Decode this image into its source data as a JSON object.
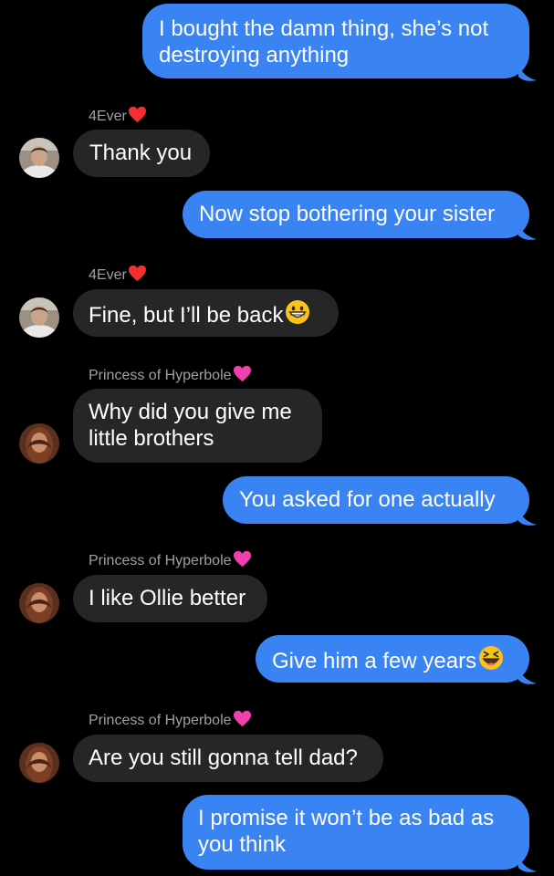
{
  "conversation": {
    "messages": [
      {
        "id": "m1",
        "direction": "outgoing",
        "lines": [
          "I bought the damn thing, she’s not",
          "destroying anything"
        ]
      },
      {
        "id": "m2",
        "direction": "incoming",
        "sender": "4Ever",
        "sender_emoji": "red-heart",
        "lines": [
          "Thank you"
        ]
      },
      {
        "id": "m3",
        "direction": "outgoing",
        "lines": [
          "Now stop bothering your sister"
        ]
      },
      {
        "id": "m4",
        "direction": "incoming",
        "sender": "4Ever",
        "sender_emoji": "red-heart",
        "lines": [
          "Fine, but I’ll be back"
        ],
        "trailing_emoji": "grinning-face"
      },
      {
        "id": "m5",
        "direction": "incoming",
        "sender": "Princess of Hyperbole",
        "sender_emoji": "pink-heart",
        "lines": [
          "Why did you give me",
          "little brothers"
        ]
      },
      {
        "id": "m6",
        "direction": "outgoing",
        "lines": [
          "You asked for one actually"
        ]
      },
      {
        "id": "m7",
        "direction": "incoming",
        "sender": "Princess of Hyperbole",
        "sender_emoji": "pink-heart",
        "lines": [
          "I like Ollie better"
        ]
      },
      {
        "id": "m8",
        "direction": "outgoing",
        "lines": [
          "Give him a few years"
        ],
        "trailing_emoji": "laughing-squinting-face"
      },
      {
        "id": "m9",
        "direction": "incoming",
        "sender": "Princess of Hyperbole",
        "sender_emoji": "pink-heart",
        "lines": [
          "Are you still gonna tell dad?"
        ]
      },
      {
        "id": "m10",
        "direction": "outgoing",
        "lines": [
          "I promise it won’t be as bad as",
          "you think"
        ]
      }
    ]
  },
  "colors": {
    "background": "#000000",
    "outgoing_bubble": "#3a83f3",
    "incoming_bubble": "#262629",
    "sender_name": "#a0a0a5"
  }
}
